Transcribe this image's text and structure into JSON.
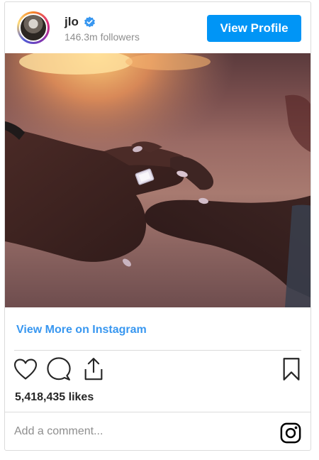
{
  "post": {
    "username": "jlo",
    "followers": "146.3m followers",
    "view_profile_label": "View Profile",
    "view_more_label": "View More on Instagram",
    "likes": "5,418,435 likes",
    "comment_placeholder": "Add a comment..."
  },
  "icons": {
    "verified": "verified-badge-icon",
    "like": "heart-icon",
    "comment": "comment-bubble-icon",
    "share": "share-icon",
    "save": "bookmark-icon",
    "instagram": "instagram-logo-icon"
  },
  "colors": {
    "accent": "#0095f6",
    "link": "#3897f0",
    "verified": "#3897f0",
    "text": "#262626",
    "muted": "#8e8e8e",
    "border": "#dbdbdb"
  }
}
